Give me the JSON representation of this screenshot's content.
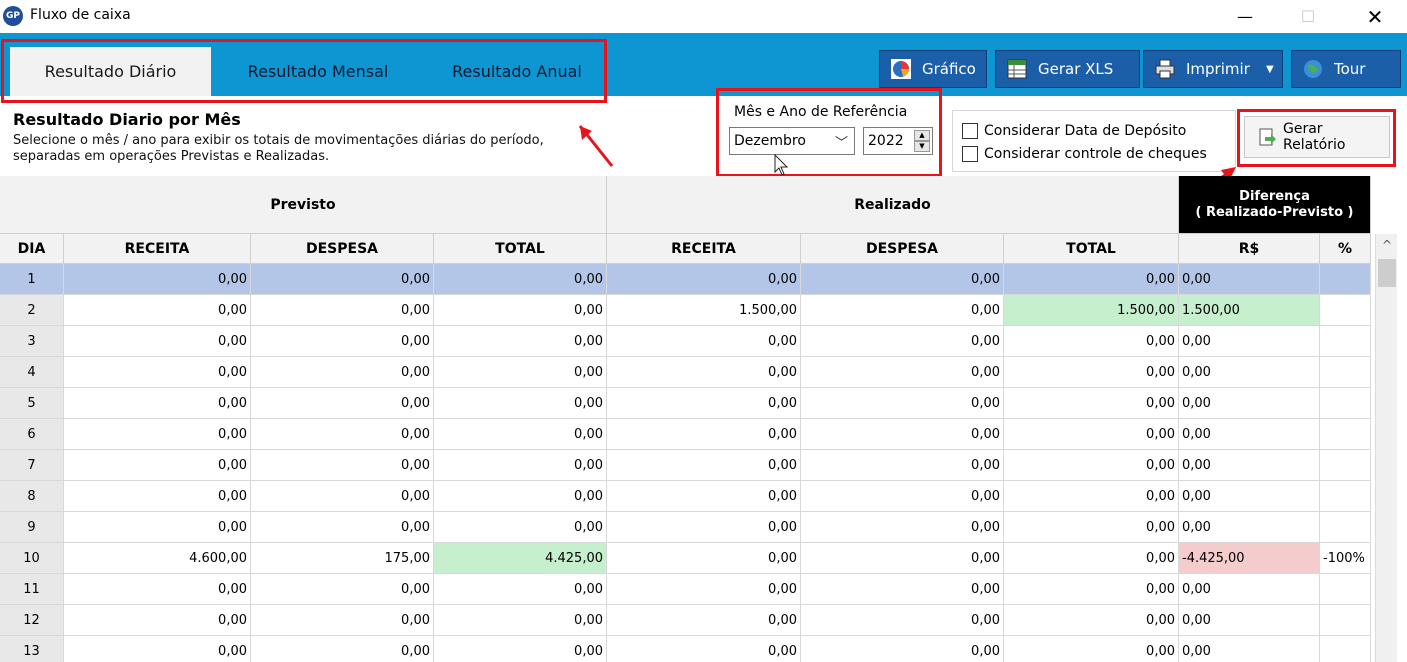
{
  "window": {
    "app_icon": "GP",
    "title": "Fluxo de caixa",
    "minimize": "—",
    "maximize": "☐",
    "close": "✕"
  },
  "tabs": [
    {
      "label": "Resultado Diário",
      "active": true
    },
    {
      "label": "Resultado Mensal",
      "active": false
    },
    {
      "label": "Resultado Anual",
      "active": false
    }
  ],
  "toolbar": {
    "grafico": "Gráfico",
    "gerar_xls": "Gerar XLS",
    "imprimir": "Imprimir",
    "tour": "Tour"
  },
  "header": {
    "title": "Resultado Diario por Mês",
    "description": "Selecione o mês / ano para exibir os totais de movimentações diárias do período, separadas em operações Previstas e Realizadas."
  },
  "reference": {
    "legend": "Mês e Ano de Referência",
    "month": "Dezembro",
    "year": "2022"
  },
  "options": {
    "data_deposito": "Considerar Data de Depósito",
    "controle_cheques": "Considerar controle de cheques"
  },
  "gerar_relatorio": "Gerar Relatório",
  "grid": {
    "group_previsto": "Previsto",
    "group_realizado": "Realizado",
    "group_diferenca_1": "Diferença",
    "group_diferenca_2": "( Realizado-Previsto )",
    "columns": [
      "DIA",
      "RECEITA",
      "DESPESA",
      "TOTAL",
      "RECEITA",
      "DESPESA",
      "TOTAL",
      "R$",
      "%"
    ],
    "rows": [
      {
        "dia": "1",
        "prev_receita": "0,00",
        "prev_despesa": "0,00",
        "prev_total": "0,00",
        "real_receita": "0,00",
        "real_despesa": "0,00",
        "real_total": "0,00",
        "dif_rs": "0,00",
        "dif_pct": ""
      },
      {
        "dia": "2",
        "prev_receita": "0,00",
        "prev_despesa": "0,00",
        "prev_total": "0,00",
        "real_receita": "1.500,00",
        "real_despesa": "0,00",
        "real_total": "1.500,00",
        "dif_rs": "1.500,00",
        "dif_pct": ""
      },
      {
        "dia": "3",
        "prev_receita": "0,00",
        "prev_despesa": "0,00",
        "prev_total": "0,00",
        "real_receita": "0,00",
        "real_despesa": "0,00",
        "real_total": "0,00",
        "dif_rs": "0,00",
        "dif_pct": ""
      },
      {
        "dia": "4",
        "prev_receita": "0,00",
        "prev_despesa": "0,00",
        "prev_total": "0,00",
        "real_receita": "0,00",
        "real_despesa": "0,00",
        "real_total": "0,00",
        "dif_rs": "0,00",
        "dif_pct": ""
      },
      {
        "dia": "5",
        "prev_receita": "0,00",
        "prev_despesa": "0,00",
        "prev_total": "0,00",
        "real_receita": "0,00",
        "real_despesa": "0,00",
        "real_total": "0,00",
        "dif_rs": "0,00",
        "dif_pct": ""
      },
      {
        "dia": "6",
        "prev_receita": "0,00",
        "prev_despesa": "0,00",
        "prev_total": "0,00",
        "real_receita": "0,00",
        "real_despesa": "0,00",
        "real_total": "0,00",
        "dif_rs": "0,00",
        "dif_pct": ""
      },
      {
        "dia": "7",
        "prev_receita": "0,00",
        "prev_despesa": "0,00",
        "prev_total": "0,00",
        "real_receita": "0,00",
        "real_despesa": "0,00",
        "real_total": "0,00",
        "dif_rs": "0,00",
        "dif_pct": ""
      },
      {
        "dia": "8",
        "prev_receita": "0,00",
        "prev_despesa": "0,00",
        "prev_total": "0,00",
        "real_receita": "0,00",
        "real_despesa": "0,00",
        "real_total": "0,00",
        "dif_rs": "0,00",
        "dif_pct": ""
      },
      {
        "dia": "9",
        "prev_receita": "0,00",
        "prev_despesa": "0,00",
        "prev_total": "0,00",
        "real_receita": "0,00",
        "real_despesa": "0,00",
        "real_total": "0,00",
        "dif_rs": "0,00",
        "dif_pct": ""
      },
      {
        "dia": "10",
        "prev_receita": "4.600,00",
        "prev_despesa": "175,00",
        "prev_total": "4.425,00",
        "real_receita": "0,00",
        "real_despesa": "0,00",
        "real_total": "0,00",
        "dif_rs": "-4.425,00",
        "dif_pct": "-100%"
      },
      {
        "dia": "11",
        "prev_receita": "0,00",
        "prev_despesa": "0,00",
        "prev_total": "0,00",
        "real_receita": "0,00",
        "real_despesa": "0,00",
        "real_total": "0,00",
        "dif_rs": "0,00",
        "dif_pct": ""
      },
      {
        "dia": "12",
        "prev_receita": "0,00",
        "prev_despesa": "0,00",
        "prev_total": "0,00",
        "real_receita": "0,00",
        "real_despesa": "0,00",
        "real_total": "0,00",
        "dif_rs": "0,00",
        "dif_pct": ""
      },
      {
        "dia": "13",
        "prev_receita": "0,00",
        "prev_despesa": "0,00",
        "prev_total": "0,00",
        "real_receita": "0,00",
        "real_despesa": "0,00",
        "real_total": "0,00",
        "dif_rs": "0,00",
        "dif_pct": ""
      }
    ]
  },
  "colors": {
    "ribbon": "#0d96d1",
    "button": "#1b5fa8",
    "highlight": "#e8141c",
    "selected_row": "#b4c6e7",
    "positive": "#c6efce",
    "negative": "#f4cccc"
  }
}
